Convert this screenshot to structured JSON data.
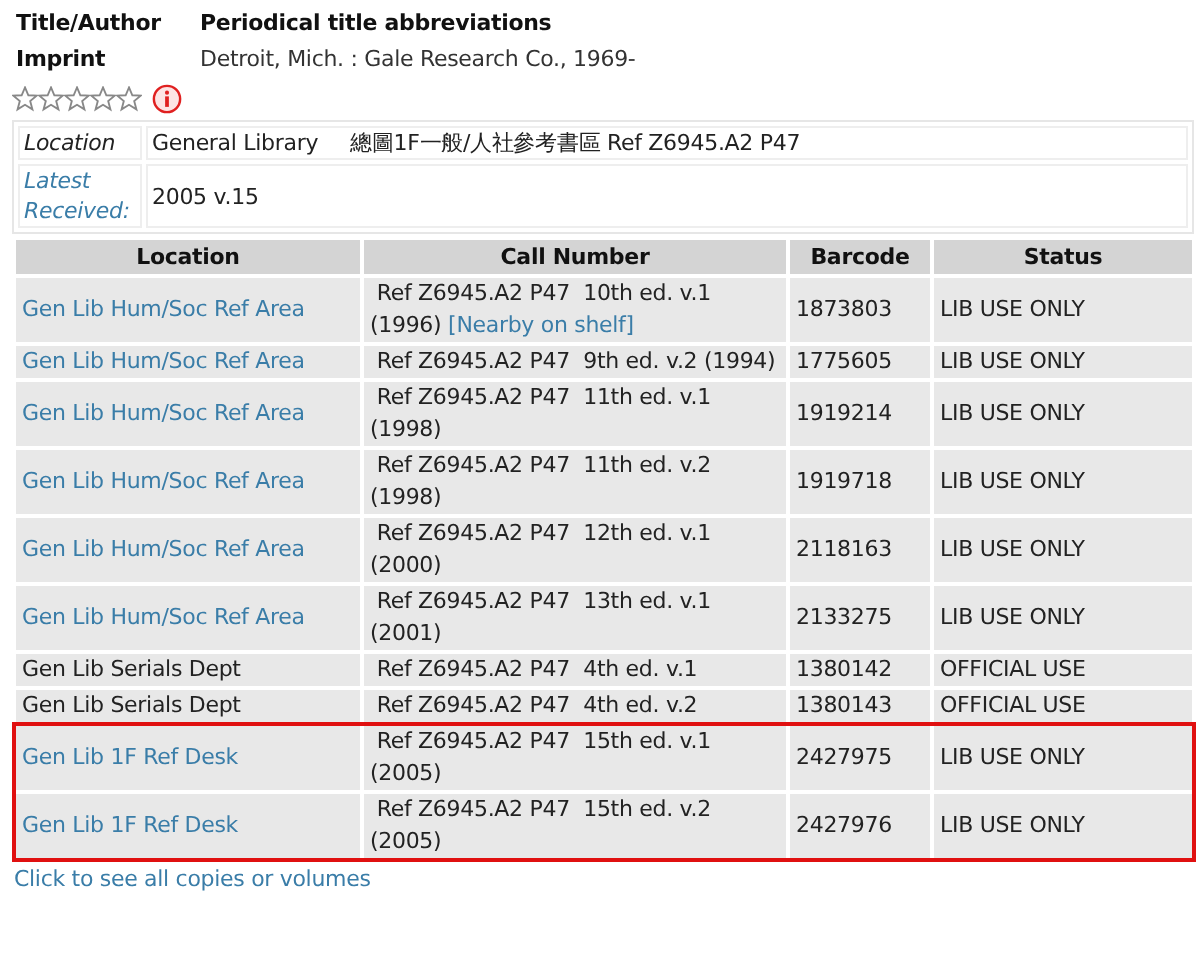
{
  "record": {
    "fields": [
      {
        "label": "Title/Author",
        "value": "Periodical title abbreviations",
        "bold": true
      },
      {
        "label": "Imprint",
        "value": "Detroit, Mich. : Gale Research Co., 1969-",
        "bold": false
      }
    ],
    "stars": 0
  },
  "summary": [
    {
      "label": "Location",
      "link": false,
      "value": "General Library",
      "extra": "總圖1F一般/人社參考書區 Ref Z6945.A2 P47"
    },
    {
      "label": "Latest Received:",
      "link": true,
      "value": "2005 v.15"
    }
  ],
  "table": {
    "columns": [
      "Location",
      "Call Number",
      "Barcode",
      "Status"
    ],
    "rows": [
      {
        "location": "Gen Lib Hum/Soc Ref Area",
        "link": true,
        "call_number": " Ref Z6945.A2 P47  10th ed. v.1 (1996)",
        "nearby": "[Nearby on shelf]",
        "barcode": "1873803",
        "status": "LIB USE ONLY",
        "highlighted": false
      },
      {
        "location": "Gen Lib Hum/Soc Ref Area",
        "link": true,
        "call_number": " Ref Z6945.A2 P47  9th ed. v.2 (1994)",
        "barcode": "1775605",
        "status": "LIB USE ONLY",
        "highlighted": false
      },
      {
        "location": "Gen Lib Hum/Soc Ref Area",
        "link": true,
        "call_number": " Ref Z6945.A2 P47  11th ed. v.1 (1998)",
        "barcode": "1919214",
        "status": "LIB USE ONLY",
        "highlighted": false
      },
      {
        "location": "Gen Lib Hum/Soc Ref Area",
        "link": true,
        "call_number": " Ref Z6945.A2 P47  11th ed. v.2 (1998)",
        "barcode": "1919718",
        "status": "LIB USE ONLY",
        "highlighted": false
      },
      {
        "location": "Gen Lib Hum/Soc Ref Area",
        "link": true,
        "call_number": " Ref Z6945.A2 P47  12th ed. v.1 (2000)",
        "barcode": "2118163",
        "status": "LIB USE ONLY",
        "highlighted": false
      },
      {
        "location": "Gen Lib Hum/Soc Ref Area",
        "link": true,
        "call_number": " Ref Z6945.A2 P47  13th ed. v.1 (2001)",
        "barcode": "2133275",
        "status": "LIB USE ONLY",
        "highlighted": false
      },
      {
        "location": "Gen Lib Serials Dept",
        "link": false,
        "call_number": " Ref Z6945.A2 P47  4th ed. v.1",
        "barcode": "1380142",
        "status": "OFFICIAL USE",
        "highlighted": false
      },
      {
        "location": "Gen Lib Serials Dept",
        "link": false,
        "call_number": " Ref Z6945.A2 P47  4th ed. v.2",
        "barcode": "1380143",
        "status": "OFFICIAL USE",
        "highlighted": false
      },
      {
        "location": "Gen Lib 1F Ref Desk",
        "link": true,
        "call_number": " Ref Z6945.A2 P47  15th ed. v.1 (2005)",
        "barcode": "2427975",
        "status": "LIB USE ONLY",
        "highlighted": true
      },
      {
        "location": "Gen Lib 1F Ref Desk",
        "link": true,
        "call_number": " Ref Z6945.A2 P47  15th ed. v.2 (2005)",
        "barcode": "2427976",
        "status": "LIB USE ONLY",
        "highlighted": true
      }
    ]
  },
  "more_link": "Click to see all copies or volumes"
}
